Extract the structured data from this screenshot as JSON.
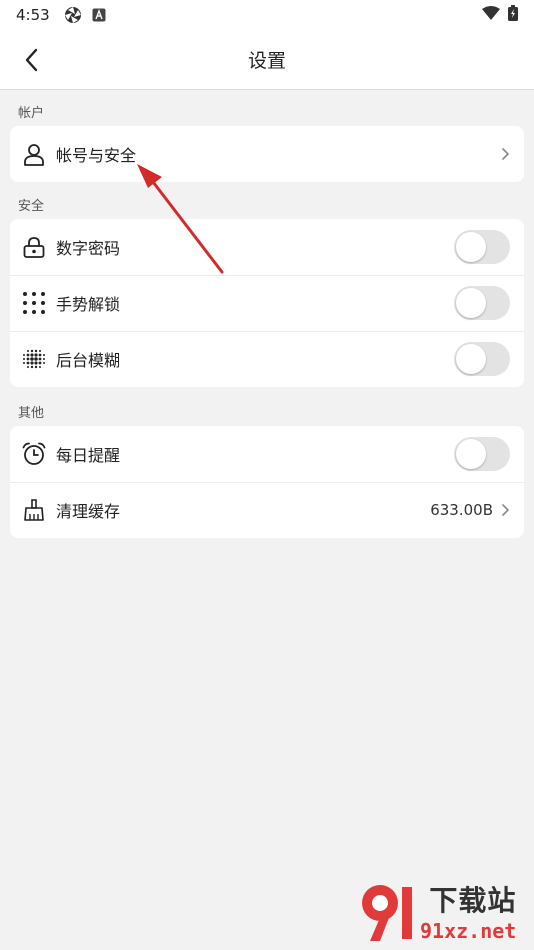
{
  "status_bar": {
    "time": "4:53"
  },
  "app_bar": {
    "title": "设置"
  },
  "sections": {
    "account": {
      "label": "帐户",
      "items": [
        {
          "label": "帐号与安全"
        }
      ]
    },
    "security": {
      "label": "安全",
      "items": [
        {
          "label": "数字密码",
          "toggle_on": false
        },
        {
          "label": "手势解锁",
          "toggle_on": false
        },
        {
          "label": "后台模糊",
          "toggle_on": false
        }
      ]
    },
    "other": {
      "label": "其他",
      "items": [
        {
          "label": "每日提醒",
          "toggle_on": false
        },
        {
          "label": "清理缓存",
          "value": "633.00B"
        }
      ]
    }
  },
  "watermark": {
    "cn": "下载站",
    "en": "91xz.net"
  },
  "colors": {
    "background": "#f2f2f2",
    "card": "#ffffff",
    "toggle_off": "#e3e3e3",
    "annotation_arrow": "#d42a2a"
  },
  "icons": {
    "back": "chevron-left-icon",
    "account": "user-icon",
    "pin": "lock-icon",
    "gesture": "dot-grid-icon",
    "blur": "blur-dots-icon",
    "reminder": "alarm-clock-icon",
    "cache": "broom-icon"
  }
}
